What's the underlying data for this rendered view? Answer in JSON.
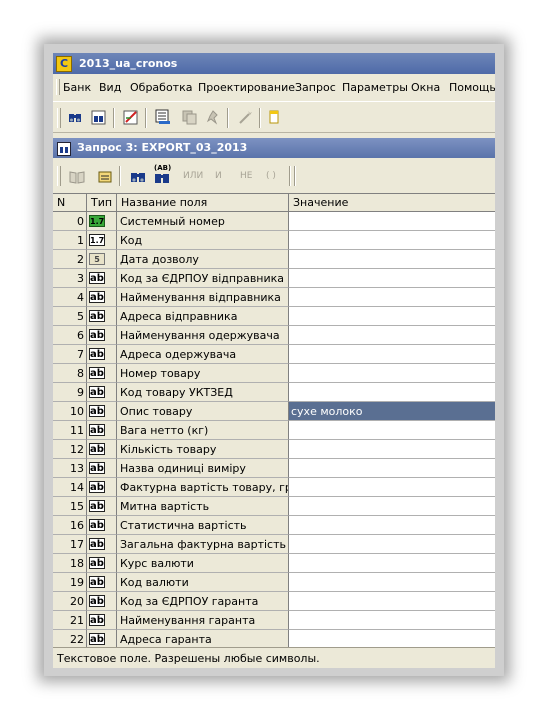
{
  "app": {
    "title": "2013_ua_cronos",
    "icon_letter": "C"
  },
  "menu": [
    "Банк",
    "Вид",
    "Обработка",
    "Проектирование",
    "Запрос",
    "Параметры",
    "Окна",
    "Помощь"
  ],
  "toolbar_icons": [
    "binoculars-icon",
    "binoculars-page-icon",
    "edit-pencil-icon",
    "report-icon",
    "copy-icon",
    "pin-icon",
    "magic-icon",
    "note-icon"
  ],
  "child_window": {
    "title": "Запрос 3: EXPORT_03_2013"
  },
  "query_toolbar": {
    "ab_label": "(AB)",
    "or_label": "ИЛИ",
    "and_label": "И",
    "not_label": "НЕ",
    "paren_label": "( )"
  },
  "table": {
    "columns": {
      "n": "N",
      "type": "Тип",
      "field": "Название поля",
      "value": "Значение"
    },
    "rows": [
      {
        "n": "0",
        "type": "1.7",
        "field": "Системный номер",
        "value": ""
      },
      {
        "n": "1",
        "type": "1.7",
        "field": "Код",
        "value": ""
      },
      {
        "n": "2",
        "type": "5",
        "field": "Дата дозволу",
        "value": ""
      },
      {
        "n": "3",
        "type": "ab",
        "field": "Код за ЄДРПОУ відправника",
        "value": ""
      },
      {
        "n": "4",
        "type": "ab",
        "field": "Найменування відправника",
        "value": ""
      },
      {
        "n": "5",
        "type": "ab",
        "field": "Адреса відправника",
        "value": ""
      },
      {
        "n": "6",
        "type": "ab",
        "field": "Найменування одержувача",
        "value": ""
      },
      {
        "n": "7",
        "type": "ab",
        "field": "Адреса одержувача",
        "value": ""
      },
      {
        "n": "8",
        "type": "ab",
        "field": "Номер товару",
        "value": ""
      },
      {
        "n": "9",
        "type": "ab",
        "field": "Код товару УКТЗЕД",
        "value": ""
      },
      {
        "n": "10",
        "type": "ab",
        "field": "Опис товару",
        "value": "сухе молоко"
      },
      {
        "n": "11",
        "type": "ab",
        "field": "Вага нетто (кг)",
        "value": ""
      },
      {
        "n": "12",
        "type": "ab",
        "field": "Кількість товару",
        "value": ""
      },
      {
        "n": "13",
        "type": "ab",
        "field": "Назва одиниці виміру",
        "value": ""
      },
      {
        "n": "14",
        "type": "ab",
        "field": "Фактурна вартість товару, грн",
        "value": ""
      },
      {
        "n": "15",
        "type": "ab",
        "field": "Митна вартість",
        "value": ""
      },
      {
        "n": "16",
        "type": "ab",
        "field": "Статистична вартість",
        "value": ""
      },
      {
        "n": "17",
        "type": "ab",
        "field": "Загальна фактурна вартість",
        "value": ""
      },
      {
        "n": "18",
        "type": "ab",
        "field": "Курс валюти",
        "value": ""
      },
      {
        "n": "19",
        "type": "ab",
        "field": "Код валюти",
        "value": ""
      },
      {
        "n": "20",
        "type": "ab",
        "field": "Код за ЄДРПОУ гаранта",
        "value": ""
      },
      {
        "n": "21",
        "type": "ab",
        "field": "Найменування гаранта",
        "value": ""
      },
      {
        "n": "22",
        "type": "ab",
        "field": "Адреса гаранта",
        "value": ""
      }
    ]
  },
  "status": "Текстовое поле. Разрешены любые символы.",
  "colors": {
    "selection": "#5a6f92",
    "titlebar": "#4e6aa8",
    "chrome": "#ece9d8"
  }
}
